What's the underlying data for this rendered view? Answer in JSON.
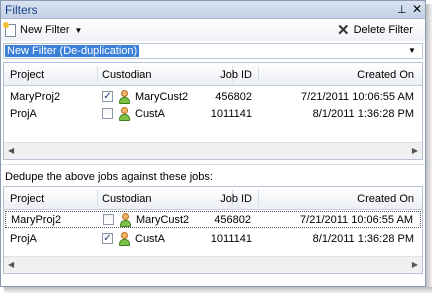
{
  "panel": {
    "title": "Filters",
    "pin_glyph": "⊥",
    "close_glyph": "✕"
  },
  "toolbar": {
    "new_filter_label": "New Filter",
    "new_filter_caret": "▼",
    "delete_filter_label": "Delete Filter",
    "delete_glyph": "✕"
  },
  "filter_select": {
    "value": "New Filter (De-duplication)",
    "arrow": "▼"
  },
  "columns": [
    "Project",
    "Custodian",
    "Job ID",
    "Created On"
  ],
  "grid1": {
    "rows": [
      {
        "project": "MaryProj2",
        "checked": true,
        "check_glyph": "✓",
        "custodian": "MaryCust2",
        "job_id": "456802",
        "created_on": "7/21/2011 10:06:55 AM"
      },
      {
        "project": "ProjA",
        "checked": false,
        "check_glyph": "",
        "custodian": "CustA",
        "job_id": "1011141",
        "created_on": "8/1/2011 1:36:28 PM"
      }
    ]
  },
  "dedupe_caption": "Dedupe the above jobs against these jobs:",
  "grid2": {
    "rows": [
      {
        "project": "MaryProj2",
        "checked": false,
        "check_glyph": "",
        "custodian": "MaryCust2",
        "job_id": "456802",
        "created_on": "7/21/2011 10:06:55 AM"
      },
      {
        "project": "ProjA",
        "checked": true,
        "check_glyph": "✓",
        "custodian": "CustA",
        "job_id": "1011141",
        "created_on": "8/1/2011 1:36:28 PM"
      }
    ]
  },
  "scroll": {
    "left": "◀",
    "right": "▶"
  },
  "icons": {
    "new_filter": "new-document-icon",
    "delete": "delete-x-icon",
    "custodian": "person-icon",
    "pin": "pin-icon",
    "close": "close-icon"
  }
}
